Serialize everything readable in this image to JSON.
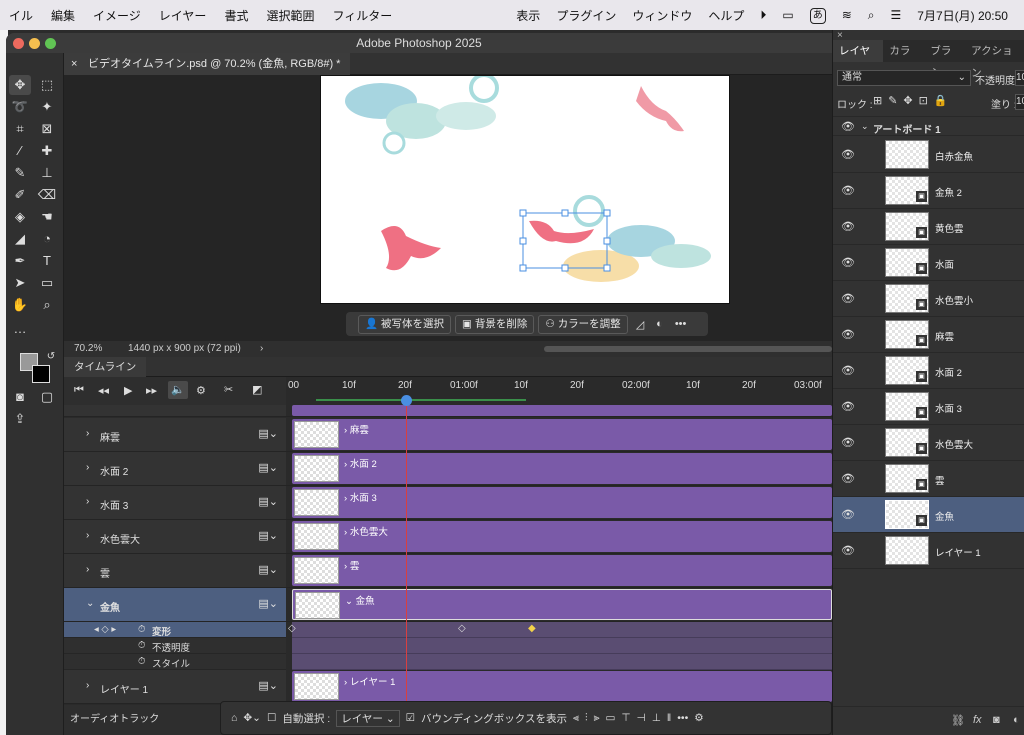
{
  "menubar": {
    "items": [
      "イル",
      "編集",
      "イメージ",
      "レイヤー",
      "書式",
      "選択範囲",
      "フィルター"
    ],
    "right_items": [
      "表示",
      "プラグイン",
      "ウィンドウ",
      "ヘルプ"
    ],
    "input_mode": "あ",
    "datetime": "7月7日(月)  20:50"
  },
  "window": {
    "title": "Adobe Photoshop 2025",
    "doc_tab": "ビデオタイムライン.psd @ 70.2% (金魚, RGB/8#) *"
  },
  "context_bar": {
    "select_subject": "被写体を選択",
    "remove_bg": "背景を削除",
    "adjust_color": "カラーを調整"
  },
  "status": {
    "zoom": "70.2%",
    "doc_size": "1440 px x 900 px (72 ppi)"
  },
  "timeline": {
    "tab": "タイムライン",
    "ruler_ticks": [
      "00",
      "10f",
      "20f",
      "01:00f",
      "10f",
      "20f",
      "02:00f",
      "10f",
      "20f",
      "03:00f"
    ],
    "rows": [
      {
        "name": "麻雲",
        "clip": "麻雲"
      },
      {
        "name": "水面 2",
        "clip": "水面 2"
      },
      {
        "name": "水面 3",
        "clip": "水面 3"
      },
      {
        "name": "水色雲大",
        "clip": "水色雲大"
      },
      {
        "name": "雲",
        "clip": "雲"
      },
      {
        "name": "金魚",
        "clip": "金魚"
      }
    ],
    "sub_props": [
      "変形",
      "不透明度",
      "スタイル"
    ],
    "last_row": {
      "name": "レイヤー 1",
      "clip": "レイヤー 1"
    },
    "audio_track": "オーディオトラック"
  },
  "bottom_toolbar": {
    "auto_select": "自動選択 :",
    "layer_dropdown": "レイヤー",
    "bbox": "バウンディングボックスを表示"
  },
  "right_panel": {
    "tabs": [
      "レイヤー",
      "カラー",
      "ブラシ",
      "アクション"
    ],
    "blend_mode": "通常",
    "opacity_label": "不透明度 :",
    "opacity_value": "10",
    "lock_label": "ロック :",
    "fill_label": "塗り :",
    "fill_value": "10",
    "artboard": "アートボード 1",
    "layers": [
      "白赤金魚",
      "金魚 2",
      "黄色雲",
      "水面",
      "水色雲小",
      "麻雲",
      "水面 2",
      "水面 3",
      "水色雲大",
      "雲",
      "金魚",
      "レイヤー 1"
    ],
    "selected_layer": "金魚"
  },
  "colors": {
    "clip": "#7a5aa8",
    "selected": "#4d5f80",
    "playhead": "#d94040"
  }
}
